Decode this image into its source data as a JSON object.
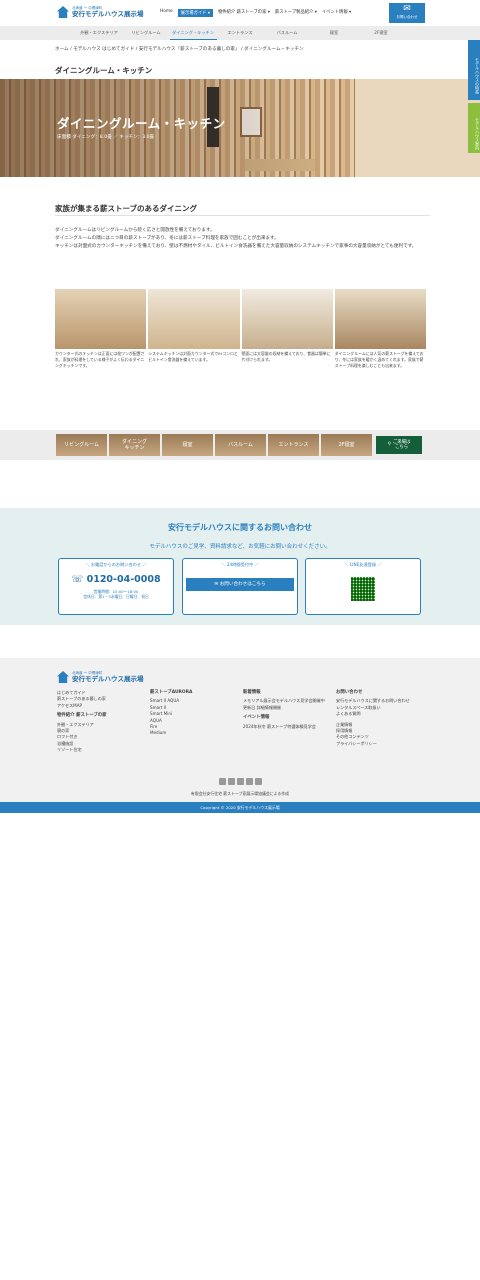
{
  "header": {
    "logo_sub": "北海道 ー 中標津町",
    "logo_main": "安行モデルハウス展示場",
    "nav": [
      "Home",
      "展示場ガイド ▾",
      "物件紹介 薪ストーブの家 ▾",
      "薪ストーブ製品紹介 ▾",
      "イベント情報 ▾"
    ],
    "mail_label": "お問い合わせ"
  },
  "subnav": [
    "外観・エクステリア",
    "リビングルーム",
    "ダイニング・キッチン",
    "エントランス",
    "バスルーム",
    "寝室",
    "2F寝室"
  ],
  "breadcrumb": "ホーム / モデルハウス はじめてガイド / 安行モデルハウス『薪ストーブのある暮しの家』 / ダイニングルーム・キッチン",
  "page_title": "ダイニングルーム・キッチン",
  "hero": {
    "heading": "ダイニングルーム・キッチン",
    "sub": "床面積 ダイニング：8.0畳 ／ キッチン：3.0畳"
  },
  "side_tabs": [
    "モデルハウスの特長",
    "モデルハウス案内"
  ],
  "section": {
    "heading": "家族が集まる薪ストーブのあるダイニング",
    "paragraphs": [
      "ダイニングルームはリビングルームから続く広さと開放性を備えております。",
      "ダイニングルームの隅にはニつ目の薪ストーブがあり、冬には薪ストーブ料理を家族で囲むことが出来ます。",
      "キッチンは対面式のカウンターキッチンを備えており、壁は不燃材やタイル、ビルトイン食洗器を備えた大容量収納のシステムキッチンで家事の大容量収納がとても便利です。"
    ]
  },
  "gallery": [
    {
      "caption": "カウンター式のキッチンは正面には桧ワンが配置され、家族が料理をしている様子がよく伝わるダイニングキッチンです。"
    },
    {
      "caption": "システムキッチンは対面カウンター式でIHコンロとビルトイン食洗器を備えています。"
    },
    {
      "caption": "壁面には大容量の収納を備えており、食器は簡単に片付けられます。"
    },
    {
      "caption": "ダイニングルームには人気の薪ストーブを備えており、冬には家族を暖かく温めてくれます。家族で薪ストーブ料理を楽しむことも出来ます。"
    }
  ],
  "room_nav": [
    "リビングルーム",
    "ダイニング\nキッチン",
    "寝室",
    "バスルーム",
    "エントランス",
    "2F寝室"
  ],
  "map_button": "ご来場は\nこちら",
  "contact": {
    "heading": "安行モデルハウスに関するお問い合わせ",
    "sub": "モデルハウスのご見学、資料請求など、お気軽にお問い合わせください。",
    "tel_title": "＼ お電話からのお問い合わせ ／",
    "tel": "0120-04-0008",
    "hours1": "営業時間：10:00～18:00",
    "hours2": "定休日：第1・3水曜日、日曜日、祝日",
    "web_title": "＼ 24時間受付中 ／",
    "web_button": "お問い合わせはこちら",
    "line_title": "＼ LINE友達登録 ／"
  },
  "footer": {
    "col1": [
      "はじめてガイド",
      "薪ストーブのある暮しの家",
      "アクセスMAP"
    ],
    "col1b_title": "物件紹介 薪ストーブの家",
    "col1b": [
      "外観・エクステリア",
      "寝の家",
      "ロフト付き",
      "浴槽施設",
      "リゾート住宅"
    ],
    "col2_title": "薪ストーブAURORA",
    "col2": [
      "Smart II AQUA",
      "Smart II",
      "Smart Mini",
      "AQUA",
      "Fire",
      "Medium"
    ],
    "col3_title": "新着情報",
    "col3": [
      "メモリアル展示会モデルハウス見学会開催中",
      "更新日 詳細情報開催"
    ],
    "col3b_title": "イベント情報",
    "col3b": [
      "2024年秋冬 薪ストーブ特選体験見学会"
    ],
    "col4_title": "お問い合わせ",
    "col4": [
      "安行モデルハウスに関するお問い合わせ",
      "レンタルスペース取扱い",
      "よくある質問",
      "企業情報",
      "採用情報",
      "その他コンテンツ",
      "プライバシーポリシー"
    ],
    "note": "有限会社安行住宅   薪ストーブ家展示場協議会による作成",
    "copyright": "Copyright © 2020 安行モデルハウス展示場"
  },
  "colors": {
    "brand": "#2a7fbf",
    "accent_green": "#8cbf3f",
    "map_green": "#145e3a"
  }
}
